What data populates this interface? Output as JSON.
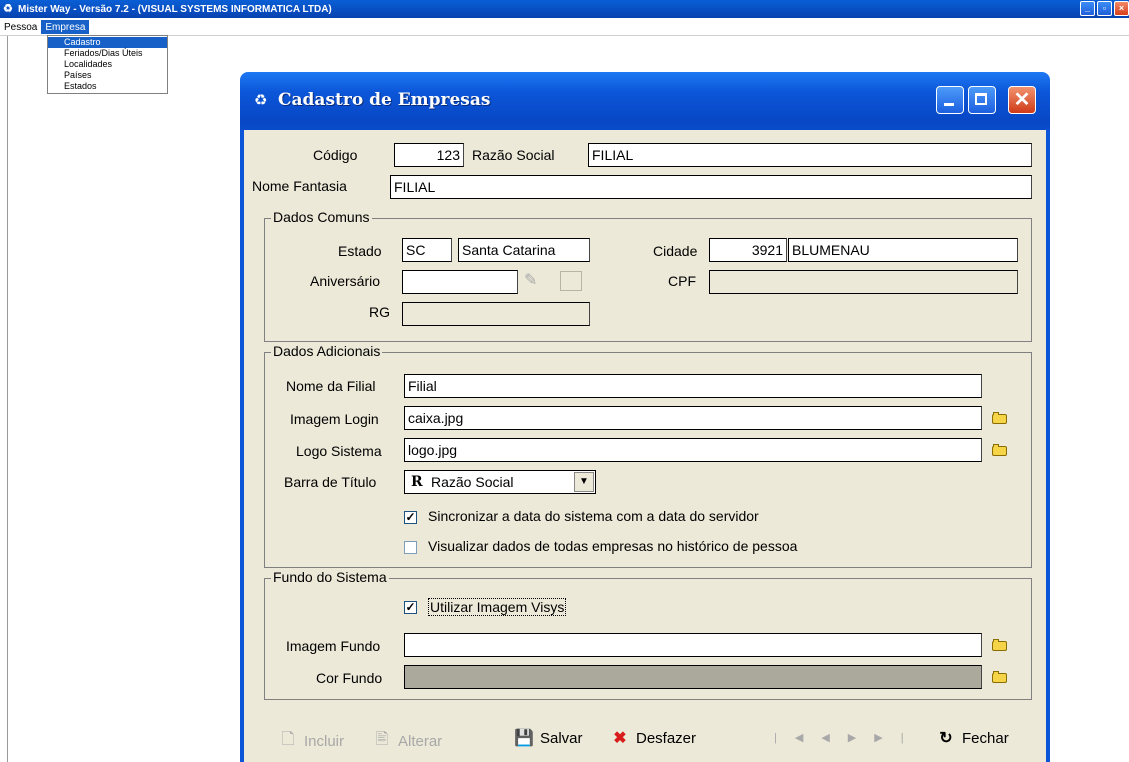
{
  "app": {
    "title": "Mister Way - Versão 7.2 - (VISUAL SYSTEMS INFORMATICA LTDA)",
    "menu": [
      "Pessoa",
      "Empresa"
    ],
    "dropdown": [
      "Cadastro",
      "Feriados/Dias Úteis",
      "Localidades",
      "Países",
      "Estados"
    ]
  },
  "dialog": {
    "title": "Cadastro de Empresas",
    "codigo_label": "Código",
    "codigo_value": "123",
    "razao_social_label": "Razão Social",
    "razao_social_value": "FILIAL",
    "nome_fantasia_label": "Nome Fantasia",
    "nome_fantasia_value": "FILIAL",
    "dados_comuns": {
      "title": "Dados Comuns",
      "estado_label": "Estado",
      "estado_sigla": "SC",
      "estado_nome": "Santa Catarina",
      "cidade_label": "Cidade",
      "cidade_codigo": "3921",
      "cidade_nome": "BLUMENAU",
      "aniversario_label": "Aniversário",
      "aniversario_value": "",
      "cpf_label": "CPF",
      "cpf_value": "",
      "rg_label": "RG",
      "rg_value": ""
    },
    "dados_adicionais": {
      "title": "Dados Adicionais",
      "nome_filial_label": "Nome da Filial",
      "nome_filial_value": "Filial",
      "imagem_login_label": "Imagem Login",
      "imagem_login_value": "caixa.jpg",
      "logo_sistema_label": "Logo Sistema",
      "logo_sistema_value": "logo.jpg",
      "barra_titulo_label": "Barra de Título",
      "barra_titulo_icon": "R",
      "barra_titulo_value": "Razão Social",
      "sync_label": "Sincronizar a data do sistema com a data do servidor",
      "sync_checked": true,
      "visualizar_label": "Visualizar dados de todas empresas no histórico de pessoa",
      "visualizar_checked": false
    },
    "fundo_sistema": {
      "title": "Fundo do Sistema",
      "utilizar_label": "Utilizar Imagem Visys",
      "utilizar_checked": true,
      "imagem_fundo_label": "Imagem Fundo",
      "imagem_fundo_value": "",
      "cor_fundo_label": "Cor Fundo",
      "cor_fundo_color": "#aba89c"
    },
    "toolbar": {
      "incluir": "Incluir",
      "alterar": "Alterar",
      "salvar": "Salvar",
      "desfazer": "Desfazer",
      "fechar": "Fechar"
    }
  },
  "colors": {
    "titlebar_blue": "#0b56d8",
    "dialog_bg": "#ece9d8",
    "menu_highlight": "#1660c8"
  }
}
